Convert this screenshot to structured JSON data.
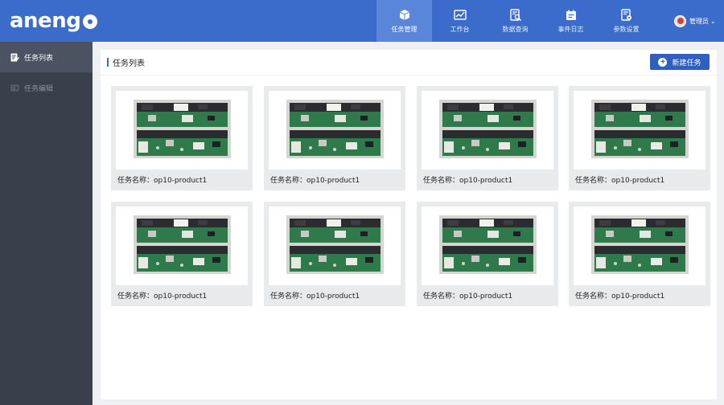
{
  "app": {
    "logo_text": "aneng"
  },
  "nav": [
    {
      "id": "task",
      "label": "任务管理",
      "icon": "cube-icon",
      "active": true
    },
    {
      "id": "workbench",
      "label": "工作台",
      "icon": "chart-icon",
      "active": false
    },
    {
      "id": "query",
      "label": "数据查询",
      "icon": "search-doc-icon",
      "active": false
    },
    {
      "id": "log",
      "label": "事件日志",
      "icon": "calendar-icon",
      "active": false
    },
    {
      "id": "settings",
      "label": "参数设置",
      "icon": "settings-doc-icon",
      "active": false
    }
  ],
  "user": {
    "name": "管理员",
    "caret": "⌄"
  },
  "sidebar": [
    {
      "label": "任务列表",
      "icon": "edit-list-icon",
      "active": true
    },
    {
      "label": "任务编辑",
      "icon": "edit-card-icon",
      "active": false
    }
  ],
  "panel": {
    "title": "任务列表",
    "new_button": "新建任务"
  },
  "tasks": [
    {
      "caption": "任务名称：op10-product1"
    },
    {
      "caption": "任务名称：op10-product1"
    },
    {
      "caption": "任务名称：op10-product1"
    },
    {
      "caption": "任务名称：op10-product1"
    },
    {
      "caption": "任务名称：op10-product1"
    },
    {
      "caption": "任务名称：op10-product1"
    },
    {
      "caption": "任务名称：op10-product1"
    },
    {
      "caption": "任务名称：op10-product1"
    }
  ],
  "colors": {
    "header": "#3b6ccc",
    "nav_active": "#5a86d9",
    "sidebar": "#393f4b",
    "button": "#2f5fbf",
    "pcb_green": "#2f7a4a"
  }
}
